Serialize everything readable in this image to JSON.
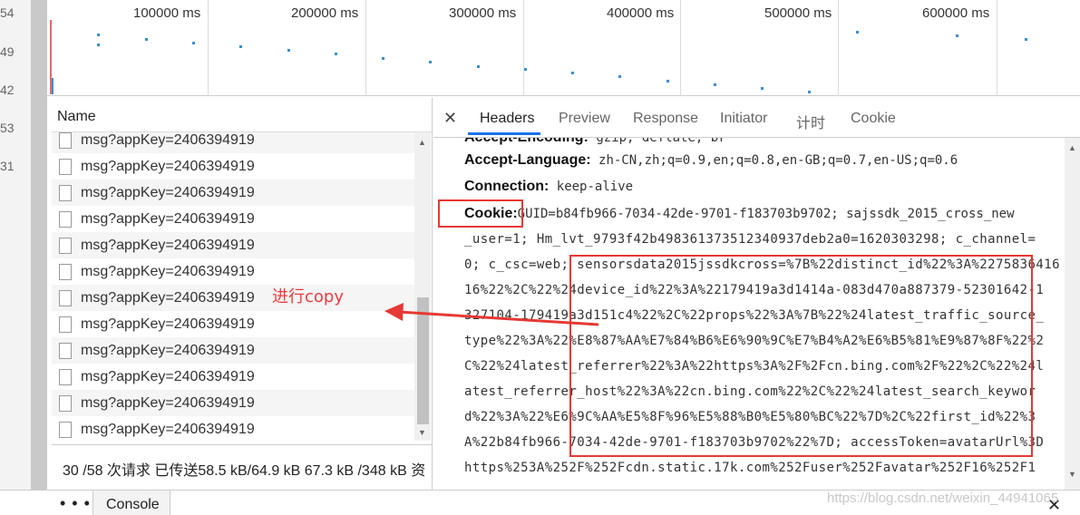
{
  "gutter": {
    "numbers": [
      "54",
      "49",
      "42",
      "53",
      "31"
    ]
  },
  "timeline": {
    "ticks": [
      "100000 ms",
      "200000 ms",
      "300000 ms",
      "400000 ms",
      "500000 ms",
      "600000 ms"
    ]
  },
  "request_list": {
    "header": "Name",
    "rows": [
      "msg?appKey=2406394919",
      "msg?appKey=2406394919",
      "msg?appKey=2406394919",
      "msg?appKey=2406394919",
      "msg?appKey=2406394919",
      "msg?appKey=2406394919",
      "msg?appKey=2406394919",
      "msg?appKey=2406394919",
      "msg?appKey=2406394919",
      "msg?appKey=2406394919",
      "msg?appKey=2406394919",
      "msg?appKey=2406394919"
    ],
    "status": "30 /58 次请求  已传送58.5 kB/64.9 kB  67.3 kB /348 kB 资"
  },
  "annotation": {
    "text": "进行copy",
    "color": "#e83b3b"
  },
  "detail": {
    "tabs": [
      "Headers",
      "Preview",
      "Response",
      "Initiator",
      "计时",
      "Cookie"
    ],
    "active_tab": "Headers",
    "headers": {
      "partial": {
        "key": "Accept-Encoding:",
        "value": "gzip, deflate, br"
      },
      "accept_language": {
        "key": "Accept-Language:",
        "value": "zh-CN,zh;q=0.9,en;q=0.8,en-GB;q=0.7,en-US;q=0.6"
      },
      "connection": {
        "key": "Connection:",
        "value": "keep-alive"
      },
      "cookie": {
        "key": "Cookie:",
        "value_first": "GUID=b84fb966-7034-42de-9701-f183703b9702; sajssdk_2015_cross_new"
      },
      "cookie_lines": [
        "_user=1; Hm_lvt_9793f42b498361373512340937deb2a0=1620303298; c_channel=",
        "0; c_csc=web; sensorsdata2015jssdkcross=%7B%22distinct_id%22%3A%2275836416",
        "16%22%2C%22%24device_id%22%3A%22179419a3d1414a-083d470a887379-52301642-1",
        "327104-179419a3d151c4%22%2C%22props%22%3A%7B%22%24latest_traffic_source_",
        "type%22%3A%22%E8%87%AA%E7%84%B6%E6%90%9C%E7%B4%A2%E6%B5%81%E9%87%8F%22%2",
        "C%22%24latest_referrer%22%3A%22https%3A%2F%2Fcn.bing.com%2F%22%2C%22%24l",
        "atest_referrer_host%22%3A%22cn.bing.com%22%2C%22%24latest_search_keywor",
        "d%22%3A%22%E6%9C%AA%E5%8F%96%E5%88%B0%E5%80%BC%22%7D%2C%22first_id%22%3",
        "A%22b84fb966-7034-42de-9701-f183703b9702%22%7D; accessToken=avatarUrl%3D",
        "https%253A%252F%252Fcdn.static.17k.com%252Fuser%252Favatar%252F16%252F1"
      ]
    }
  },
  "bottom_bar": {
    "more": "⋮",
    "console_tab": "Console",
    "close": "✕"
  },
  "watermark": "https://blog.csdn.net/weixin_44941065",
  "colors": {
    "highlight_box": "#e53935",
    "tab_underline": "#1a73e8",
    "timeline_dots": "#3a8fd0"
  }
}
